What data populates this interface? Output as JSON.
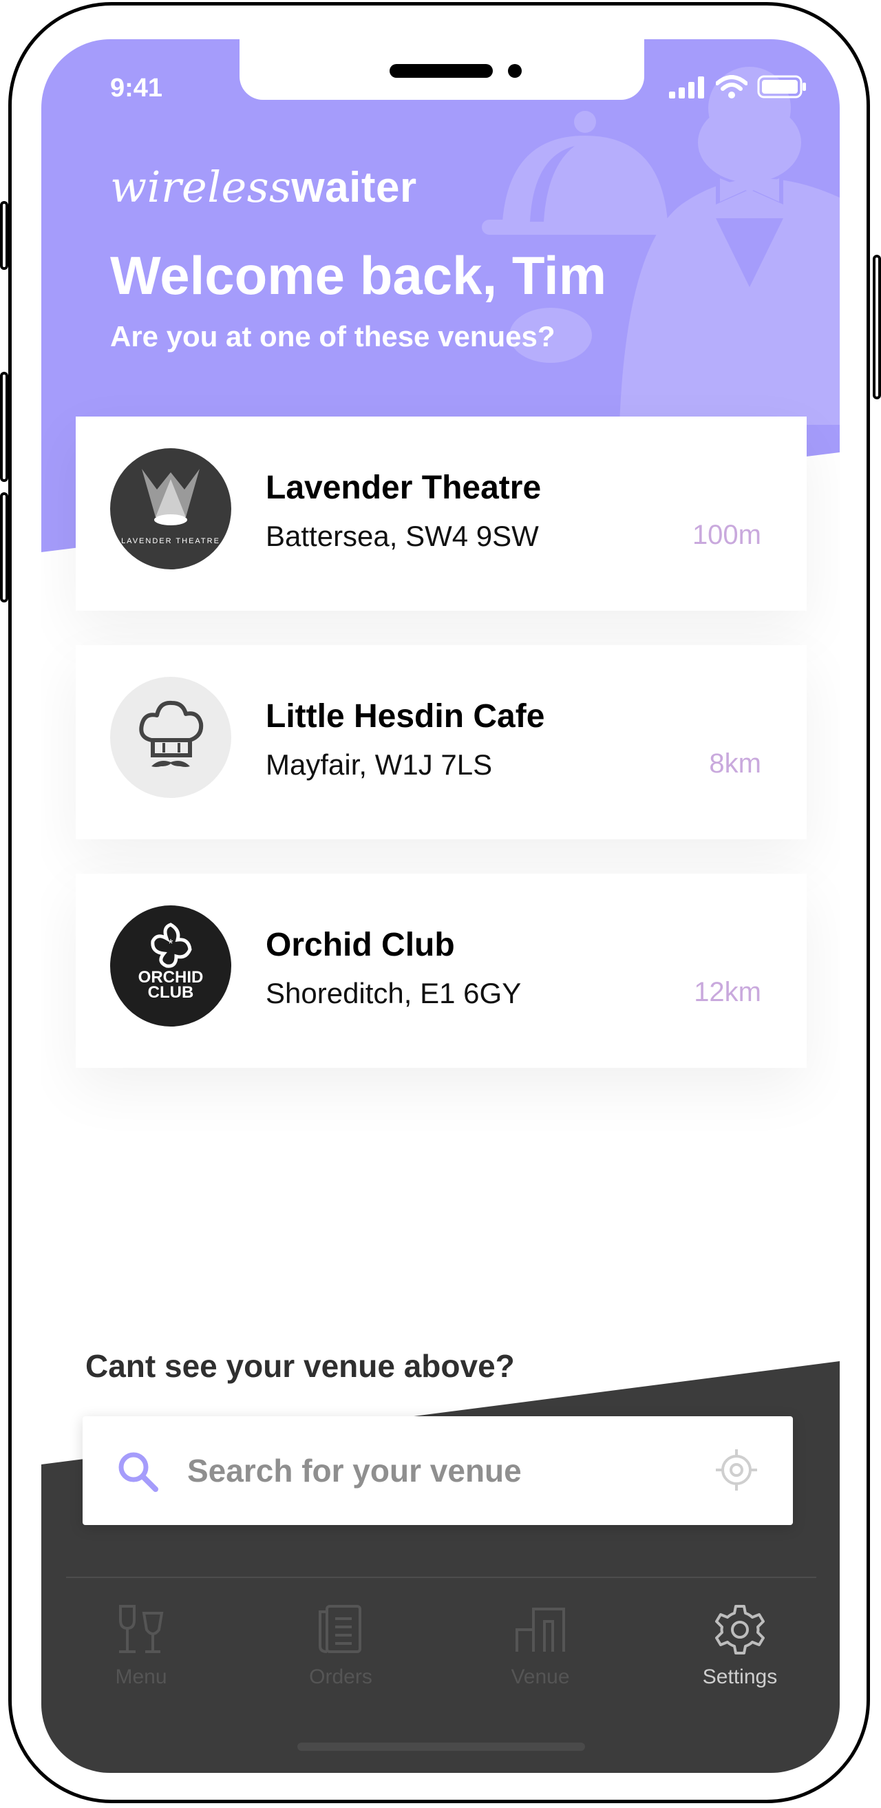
{
  "status_bar": {
    "time": "9:41"
  },
  "brand": {
    "logo_prefix": "wireless",
    "logo_suffix": "waiter"
  },
  "header": {
    "title": "Welcome back, Tim",
    "subtitle": "Are you at one of these venues?"
  },
  "venues": [
    {
      "name": "Lavender Theatre",
      "address": "Battersea, SW4 9SW",
      "distance": "100m",
      "logo_text": "LAVENDER THEATRE",
      "logo_icon": "spotlight-icon"
    },
    {
      "name": "Little Hesdin Cafe",
      "address": "Mayfair, W1J 7LS",
      "distance": "8km",
      "logo_icon": "chef-hat-moustache-icon"
    },
    {
      "name": "Orchid Club",
      "address": "Shoreditch, E1 6GY",
      "distance": "12km",
      "logo_text_1": "ORCHID",
      "logo_text_2": "CLUB",
      "logo_icon": "orchid-flower-icon"
    }
  ],
  "search": {
    "prompt": "Cant see your venue above?",
    "placeholder": "Search for your venue"
  },
  "tabbar": {
    "items": [
      {
        "label": "Menu",
        "icon": "wine-glasses-icon",
        "active": false
      },
      {
        "label": "Orders",
        "icon": "receipt-icon",
        "active": false
      },
      {
        "label": "Venue",
        "icon": "buildings-icon",
        "active": false
      },
      {
        "label": "Settings",
        "icon": "gear-icon",
        "active": true
      }
    ]
  },
  "colors": {
    "brand_purple": "#a59cfb",
    "distance_text": "#c9a9dd",
    "dark_panel": "#3c3c3c"
  }
}
